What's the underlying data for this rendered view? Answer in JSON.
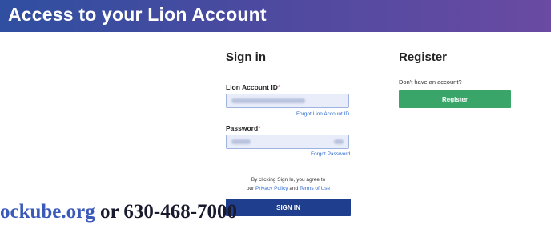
{
  "banner": {
    "title": "Access to your Lion Account"
  },
  "signin": {
    "title": "Sign in",
    "account_label": "Lion Account ID",
    "password_label": "Password",
    "forgot_id": "Forgot Lion Account ID",
    "forgot_password": "Forgot Password",
    "agreement_prefix": "By clicking Sign In, you agree to",
    "agreement_our": "our",
    "privacy": "Privacy Policy",
    "and": "and",
    "terms": "Terms of Use",
    "button": "SIGN IN"
  },
  "register": {
    "title": "Register",
    "prompt": "Don't have an account?",
    "button": "Register"
  },
  "overlay": {
    "site_text": "ockube.org",
    "rest_text": " or 630-468-7000"
  },
  "colors": {
    "banner_start": "#2f4fa0",
    "banner_end": "#6a4aa2",
    "signin_button": "#1f3e8e",
    "register_button": "#3aa569",
    "link": "#2f6bd3"
  },
  "icons": {
    "required": "asterisk"
  }
}
